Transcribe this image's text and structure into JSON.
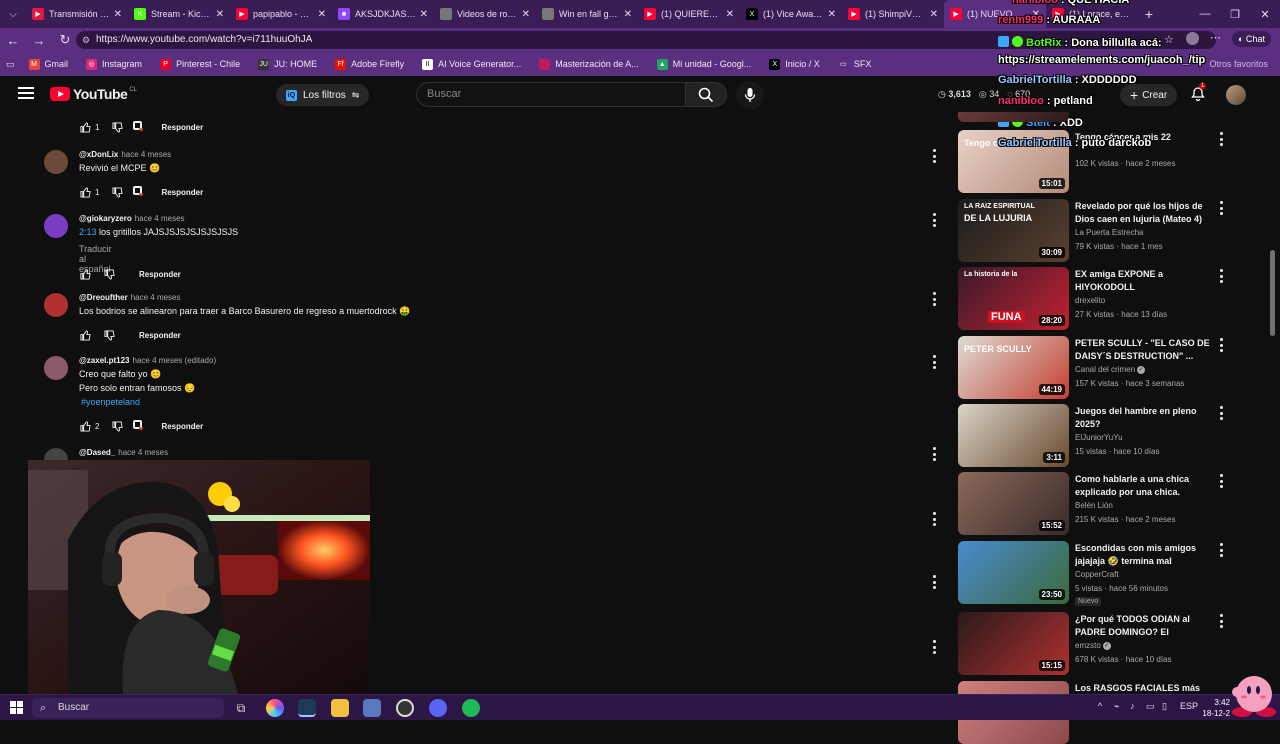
{
  "browser": {
    "tabs": [
      {
        "label": "Transmisión en vivo",
        "color": "#e5173f",
        "glyph": "▶"
      },
      {
        "label": "Stream - Kick Dash",
        "color": "#53fc18",
        "glyph": "K"
      },
      {
        "label": "papipablo - YouTube",
        "color": "#ff0033",
        "glyph": "▶"
      },
      {
        "label": "AKSJDKJASKJD M...",
        "color": "#9146ff",
        "glyph": "■"
      },
      {
        "label": "Videos de rojomo...",
        "color": "#777777",
        "glyph": ""
      },
      {
        "label": "Win en fall guys",
        "color": "#777777",
        "glyph": ""
      },
      {
        "label": "(1) QUIERES ENTR...",
        "color": "#ff0033",
        "glyph": "▶"
      },
      {
        "label": "(1) Vice Awards 2...",
        "color": "#000000",
        "glyph": "X"
      },
      {
        "label": "(1) ShimpiVT - Yo...",
        "color": "#ff0033",
        "glyph": "▶"
      },
      {
        "label": "(1) NUEVO BOTO...",
        "color": "#ff0033",
        "glyph": "▶",
        "active": true
      },
      {
        "label": "(1) Lorace, ento",
        "color": "#ff0033",
        "glyph": "▶"
      }
    ],
    "url": "https://www.youtube.com/watch?v=i711huuOhJA",
    "bookmarks": [
      {
        "label": "Gmail",
        "color": "#ea4335",
        "glyph": "M"
      },
      {
        "label": "Instagram",
        "color": "#d62976",
        "glyph": "◎"
      },
      {
        "label": "Pinterest - Chile",
        "color": "#e60023",
        "glyph": "P"
      },
      {
        "label": "JU: HOME",
        "color": "#333333",
        "glyph": "JU"
      },
      {
        "label": "Adobe Firefly",
        "color": "#eb1000",
        "glyph": "Ff"
      },
      {
        "label": "AI Voice Generator...",
        "color": "#ffffff",
        "glyph": "II"
      },
      {
        "label": "Masterización de A...",
        "color": "#c2185b",
        "glyph": ""
      },
      {
        "label": "Mi unidad - Googl...",
        "color": "#1fa463",
        "glyph": "▲"
      },
      {
        "label": "Inicio / X",
        "color": "#000000",
        "glyph": "X"
      },
      {
        "label": "SFX",
        "color": "#5a2f80",
        "glyph": "▭"
      }
    ],
    "bookmarks_right": "Otros favoritos"
  },
  "youtube": {
    "logo_text": "YouTube",
    "country": "CL",
    "filters_label": "Los filtros",
    "search_placeholder": "Buscar",
    "stats": {
      "viewers": "3,613",
      "a": "34",
      "b": "670"
    },
    "create_label": "Crear",
    "notif_count": "1"
  },
  "comments": [
    {
      "user": "",
      "time": "",
      "text": "",
      "likes": "1",
      "hearted": true,
      "reply": "Responder",
      "only_actions": true
    },
    {
      "user": "@xDonLix",
      "time": "hace 4 meses",
      "text": "Revivió el MCPE 😊",
      "likes": "1",
      "hearted": true,
      "reply": "Responder",
      "avatar": "#6b4a3a"
    },
    {
      "user": "@giokaryzero",
      "time": "hace 4 meses",
      "timestamp": "2:13",
      "text": "los gritillos JAJSJSJSJSJSJSJSJS",
      "translate": "Traducir al español",
      "likes": "",
      "hearted": false,
      "reply": "Responder",
      "avatar": "#7a3cc0"
    },
    {
      "user": "@Dreoufther",
      "time": "hace 4 meses",
      "text": "Los bodrios se alinearon para traer a Barco Basurero de regreso a muertodrock 🤑",
      "likes": "",
      "hearted": false,
      "reply": "Responder",
      "avatar": "#b03030"
    },
    {
      "user": "@zaxel.pt123",
      "time": "hace 4 meses (editado)",
      "text": "Creo que falto yo 😊",
      "text2": "Pero solo entran famosos 😔",
      "hashtag": "#yoenpeteland",
      "likes": "2",
      "hearted": true,
      "reply": "Responder",
      "avatar": "#8a5a6a"
    },
    {
      "user": "@Dased_",
      "time": "hace 4 meses",
      "text": "",
      "likes": "",
      "hearted": false,
      "reply": "",
      "avatar": "#444444"
    }
  ],
  "recommendations": [
    {
      "title": "Tengo cáncer a mis 22",
      "channel": "",
      "views": "102 K vistas",
      "age": "hace 2 meses",
      "duration": "15:01",
      "thumb": [
        "#e8d2c8",
        "#b58b78"
      ],
      "thumb_text": "Tengo cáncer"
    },
    {
      "title": "Revelado por qué los hijos de Dios caen en lujuria (Mateo 4)",
      "channel": "La Puerta Estrecha",
      "views": "79 K vistas",
      "age": "hace 1 mes",
      "duration": "30:09",
      "thumb": [
        "#1c1c1c",
        "#5a4030"
      ],
      "thumb_text": "DE LA LUJURIA",
      "thumb_sub": "LA RAIZ ESPIRITUAL"
    },
    {
      "title": "EX amiga EXPONE a HIYOKODOLL",
      "channel": "drexelito",
      "views": "27 K vistas",
      "age": "hace 13 días",
      "duration": "28:20",
      "thumb": [
        "#3a1a2a",
        "#c02030"
      ],
      "thumb_text": "FUNA",
      "thumb_sub": "La historia de la"
    },
    {
      "title": "PETER SCULLY - \"EL CASO DE DAISY´S DESTRUCTION\" ...",
      "channel": "Canal del crimen",
      "verified": true,
      "views": "157 K vistas",
      "age": "hace 3 semanas",
      "duration": "44:19",
      "thumb": [
        "#e0dcd6",
        "#c24030"
      ],
      "thumb_text": "PETER SCULLY"
    },
    {
      "title": "Juegos del hambre en pleno 2025?",
      "channel": "ElJuniorYuYu",
      "views": "15 vistas",
      "age": "hace 10 días",
      "duration": "3:11",
      "thumb": [
        "#d9d4c8",
        "#6a4a30"
      ],
      "thumb_text": ""
    },
    {
      "title": "Como hablarle a una chica explicado por una chica.",
      "channel": "Belén Lión",
      "views": "215 K vistas",
      "age": "hace 2 meses",
      "duration": "15:52",
      "thumb": [
        "#8a6a5a",
        "#3a2a2a"
      ],
      "thumb_text": ""
    },
    {
      "title": "Escondidas con mis amigos jajajaja 🤣 termina mal",
      "channel": "CopperCraft",
      "views": "5 vistas",
      "age": "hace 56 minutos",
      "duration": "23:50",
      "badge": "Nuevo",
      "thumb": [
        "#4a8ad0",
        "#3a6a3a"
      ],
      "thumb_text": ""
    },
    {
      "title": "¿Por qué TODOS ODIAN al PADRE DOMINGO? El Streame...",
      "channel": "emzsto",
      "verified": true,
      "views": "678 K vistas",
      "age": "hace 10 días",
      "duration": "15:15",
      "thumb": [
        "#2a1a1a",
        "#b03030"
      ],
      "thumb_text": ""
    },
    {
      "title": "Los RASGOS FACIALES más",
      "channel": "",
      "views": "",
      "age": "",
      "duration": "",
      "thumb": [
        "#d08080",
        "#8a4a4a"
      ],
      "thumb_text": ""
    }
  ],
  "chat": [
    {
      "user": "nanibloo",
      "color": "#ff2a6d",
      "text": "QUE HACIA"
    },
    {
      "user": "renm999",
      "color": "#ff2a6d",
      "text": "AURAAA"
    },
    {
      "user": "BotRix",
      "color": "#53fc18",
      "text": "Dona billulla acá:",
      "badges": true
    },
    {
      "user": "",
      "color": "#ffffff",
      "text": "https://streamelements.com/juacoh_/tip"
    },
    {
      "user": "GabrielTortilla",
      "color": "#9ac7ff",
      "text": "XDDDDDD"
    },
    {
      "user": "nanibloo",
      "color": "#ff2a6d",
      "text": "petland"
    },
    {
      "user": "Steit",
      "color": "#3ea6ff",
      "text": "XDD",
      "badges": true
    },
    {
      "user": "GabrielTortilla",
      "color": "#9ac7ff",
      "text": "puto darckob"
    }
  ],
  "taskbar": {
    "search_label": "Buscar",
    "lang": "ESP",
    "time": "3:42",
    "date": "18-12-2"
  }
}
